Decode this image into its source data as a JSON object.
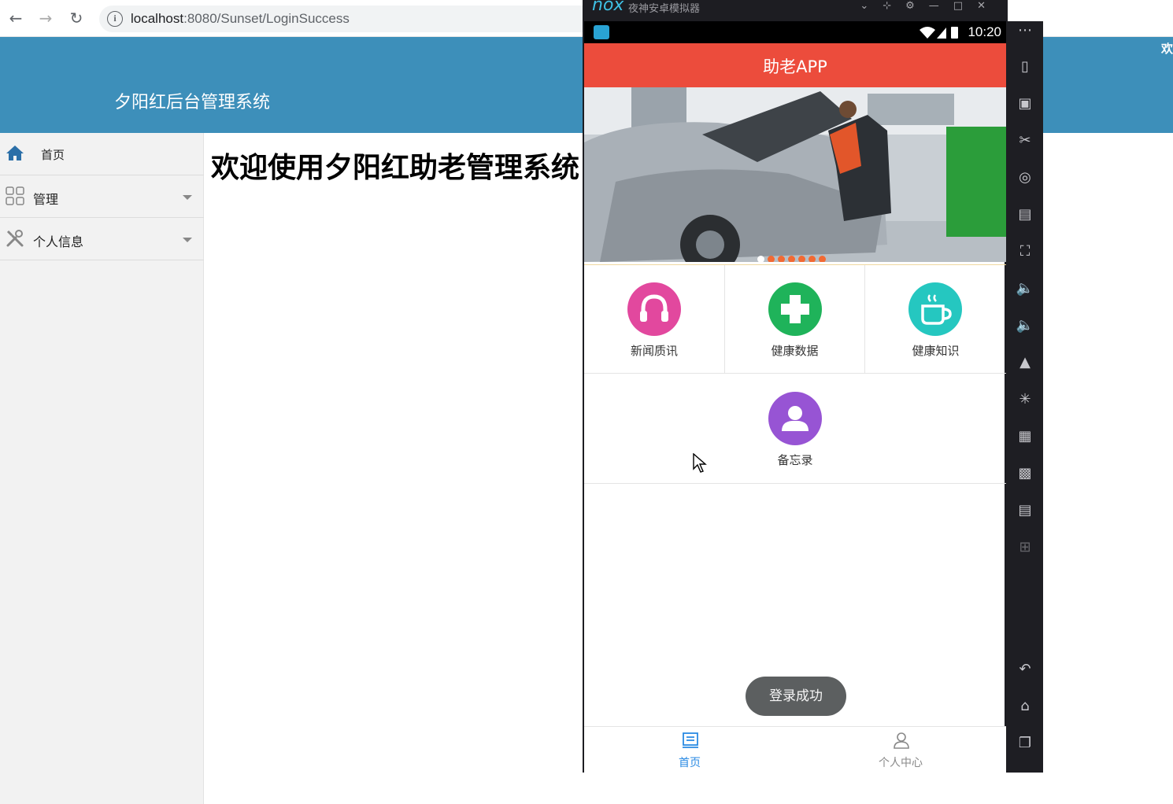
{
  "browser": {
    "url_host": "localhost",
    "url_path": ":8080/Sunset/LoginSuccess",
    "info_glyph": "i"
  },
  "admin": {
    "header_title": "夕阳红后台管理系统",
    "header_corner": "欢",
    "header_color": "#3d8fba",
    "welcome_text": "欢迎使用夕阳红助老管理系统",
    "sidebar": [
      {
        "label": "首页",
        "icon": "home-icon"
      },
      {
        "label": "管理",
        "icon": "grid-icon"
      },
      {
        "label": "个人信息",
        "icon": "tools-icon"
      }
    ]
  },
  "emulator": {
    "logo": "nox",
    "name": "夜神安卓模拟器",
    "window_controls": [
      "chevron-down-icon",
      "pin-icon",
      "gear-icon",
      "minimize-icon",
      "maximize-icon",
      "close-icon"
    ]
  },
  "phone": {
    "time": "10:20",
    "app_title": "助老APP",
    "app_bar_color": "#ec4c3c",
    "banner_dots": 7,
    "banner_active_dot": 0,
    "tiles": [
      {
        "label": "新闻质讯",
        "color": "#e2489e",
        "icon": "headphones-icon"
      },
      {
        "label": "健康数据",
        "color": "#1fb35a",
        "icon": "plus-icon"
      },
      {
        "label": "健康知识",
        "color": "#25c7c0",
        "icon": "coffee-cup-icon"
      },
      {
        "label": "备忘录",
        "color": "#9754d4",
        "icon": "user-icon"
      }
    ],
    "toast": "登录成功",
    "bottom_nav": [
      {
        "label": "首页",
        "active": true,
        "color": "#2a8ae3"
      },
      {
        "label": "个人中心",
        "active": false,
        "color": "#888888"
      }
    ]
  }
}
